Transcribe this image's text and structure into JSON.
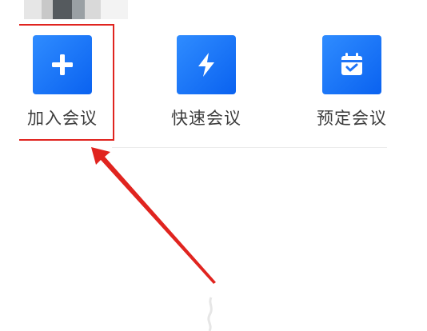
{
  "actions": [
    {
      "label": "加入会议",
      "icon": "plus-icon"
    },
    {
      "label": "快速会议",
      "icon": "lightning-icon"
    },
    {
      "label": "预定会议",
      "icon": "calendar-check-icon"
    }
  ],
  "colors": {
    "tile_start": "#2f8cff",
    "tile_end": "#0a62f0",
    "annotation_red": "#e0241f"
  }
}
